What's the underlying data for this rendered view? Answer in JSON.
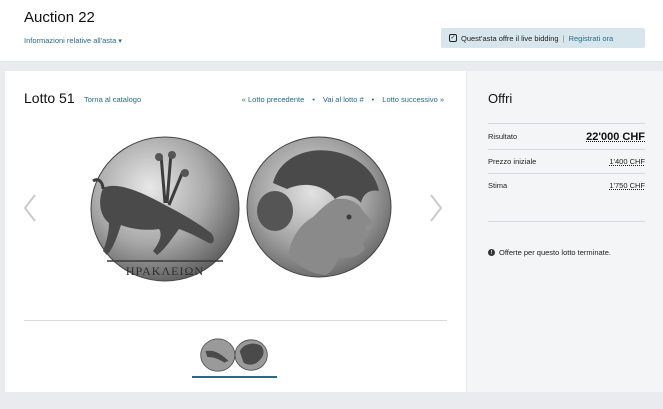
{
  "header": {
    "title": "Auction 22",
    "info_link": "Informazioni relative all'asta",
    "live_bidding_text": "Quest'asta offre il live bidding",
    "register_link": "Registrati ora"
  },
  "lot": {
    "title": "Lotto 51",
    "back_link": "Torna al catalogo",
    "nav": {
      "previous": "« Lotto precedente",
      "go_to": "Vai al lotto #",
      "next": "Lotto successivo »"
    },
    "coin_inscription": "ΗΡΑΚΛΕΙΩΝ",
    "icons": {
      "prev_arrow": "chevron-left-icon",
      "next_arrow": "chevron-right-icon"
    }
  },
  "offers": {
    "title": "Offri",
    "rows": [
      {
        "label": "Risultato",
        "value": "22'000 CHF"
      },
      {
        "label": "Prezzo iniziale",
        "value": "1'400 CHF"
      },
      {
        "label": "Stima",
        "value": "1'750 CHF"
      }
    ],
    "closed_message": "Offerte per questo lotto terminate."
  },
  "colors": {
    "link": "#2a6a8a",
    "live_box_bg": "#d6e6ec",
    "page_bg": "#e9ebee"
  }
}
